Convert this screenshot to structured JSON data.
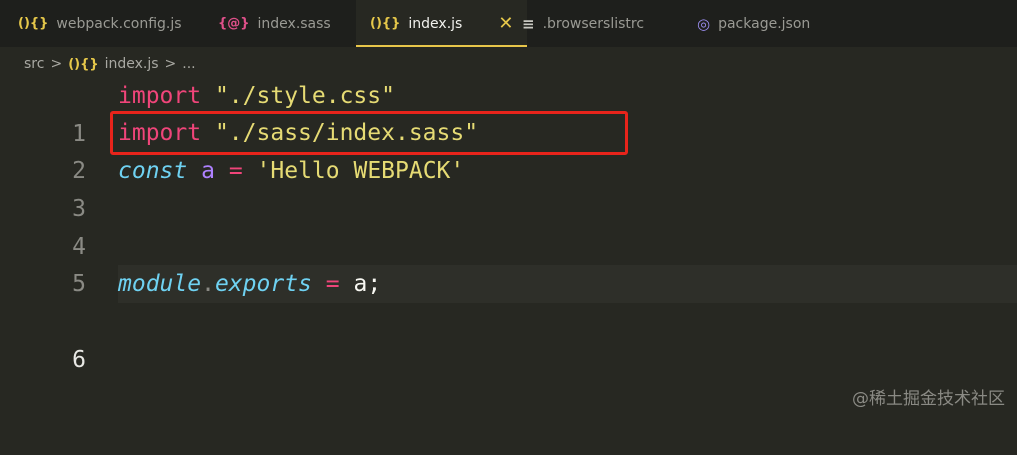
{
  "tabs": [
    {
      "icon": "(){}",
      "label": "webpack.config.js"
    },
    {
      "icon": "{@}",
      "label": "index.sass"
    },
    {
      "icon": "(){}",
      "label": "index.js",
      "active": true,
      "close": "✕"
    },
    {
      "icon": "≡",
      "label": ".browserslistrc"
    },
    {
      "icon": "◎",
      "label": "package.json"
    }
  ],
  "breadcrumb": {
    "root": "src",
    "sep": ">",
    "file": "index.js",
    "more": "..."
  },
  "editor": {
    "lines": [
      {
        "number": "1",
        "tokens": {
          "a": "import",
          "b": " ",
          "c": "\"./style.css\""
        }
      },
      {
        "number": "2",
        "tokens": {
          "a": "import",
          "b": " ",
          "c": "\"./sass/index.sass\""
        }
      },
      {
        "number": "3",
        "tokens": {
          "a": "const",
          "b": " ",
          "c": "a",
          "d": " ",
          "e": "=",
          "f": " ",
          "g": "'Hello WEBPACK'"
        }
      },
      {
        "number": "4"
      },
      {
        "number": "5"
      },
      {
        "number": "6",
        "tokens": {
          "a": "module",
          "b": ".",
          "c": "exports",
          "d": " ",
          "e": "=",
          "f": " ",
          "g": "a",
          "h": ";"
        }
      }
    ],
    "current_line": "6",
    "highlight_color": "#e8241b"
  },
  "watermark": "@稀土掘金技术社区",
  "colors": {
    "keyword": "#f0457a",
    "string": "#e6db74",
    "storage": "#6fd2f2",
    "variable": "#ae81ff",
    "tab_accent": "#e8c64a"
  }
}
